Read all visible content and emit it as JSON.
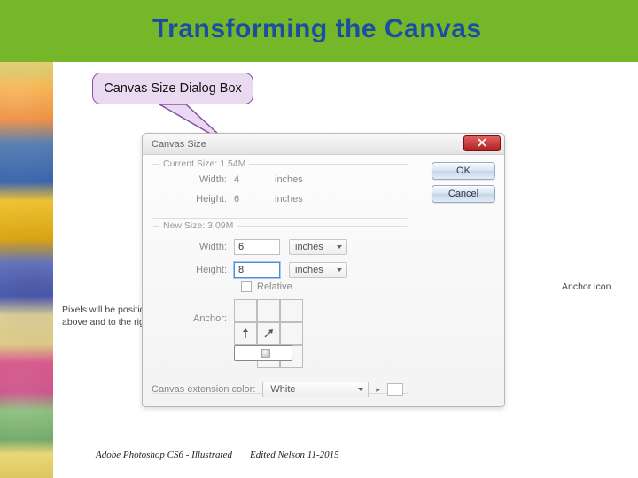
{
  "slide": {
    "title": "Transforming the Canvas",
    "callout": "Canvas Size Dialog Box",
    "footer_left": "Adobe Photoshop CS6 - Illustrated",
    "footer_right": "Edited Nelson 11-2015"
  },
  "annotations": {
    "left_line1": "Pixels will be positioned",
    "left_line2": "above and to the right",
    "right": "Anchor icon"
  },
  "dialog": {
    "title": "Canvas Size",
    "ok_label": "OK",
    "cancel_label": "Cancel",
    "current": {
      "group_title": "Current Size: 1.54M",
      "width_label": "Width:",
      "width_value": "4",
      "width_unit": "inches",
      "height_label": "Height:",
      "height_value": "6",
      "height_unit": "inches"
    },
    "new": {
      "group_title": "New Size: 3.09M",
      "width_label": "Width:",
      "width_value": "6",
      "width_unit": "inches",
      "height_label": "Height:",
      "height_value": "8",
      "height_unit": "inches",
      "relative_label": "Relative",
      "anchor_label": "Anchor:"
    },
    "extension": {
      "label": "Canvas extension color:",
      "value": "White"
    }
  }
}
